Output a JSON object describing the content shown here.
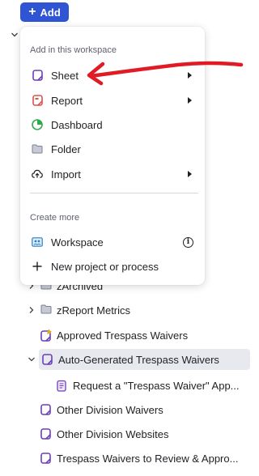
{
  "toolbar": {
    "add_label": "Add"
  },
  "menu": {
    "section_workspace": "Add in this workspace",
    "section_more": "Create more",
    "items": [
      {
        "label": "Sheet",
        "icon": "sheet-icon"
      },
      {
        "label": "Report",
        "icon": "report-icon"
      },
      {
        "label": "Dashboard",
        "icon": "dashboard-icon"
      },
      {
        "label": "Folder",
        "icon": "folder-icon"
      },
      {
        "label": "Import",
        "icon": "import-icon"
      }
    ],
    "more_items": [
      {
        "label": "Workspace",
        "icon": "workspace-icon"
      },
      {
        "label": "New project or process",
        "icon": "plus-icon"
      }
    ]
  },
  "tree": {
    "items": [
      {
        "label": "zArchived"
      },
      {
        "label": "zReport Metrics"
      },
      {
        "label": "Approved Trespass Waivers"
      },
      {
        "label": "Auto-Generated Trespass Waivers"
      },
      {
        "label": "Request a \"Trespass Waiver\" App..."
      },
      {
        "label": "Other Division Waivers"
      },
      {
        "label": "Other Division Websites"
      },
      {
        "label": "Trespass Waivers to Review & Appro..."
      }
    ]
  },
  "colors": {
    "accent": "#2f55d4",
    "sheet": "#6a3fb8",
    "report": "#d9534f",
    "dashboard": "#2faa4a",
    "folder": "#8a8fa0",
    "annotation": "#e01b24"
  }
}
